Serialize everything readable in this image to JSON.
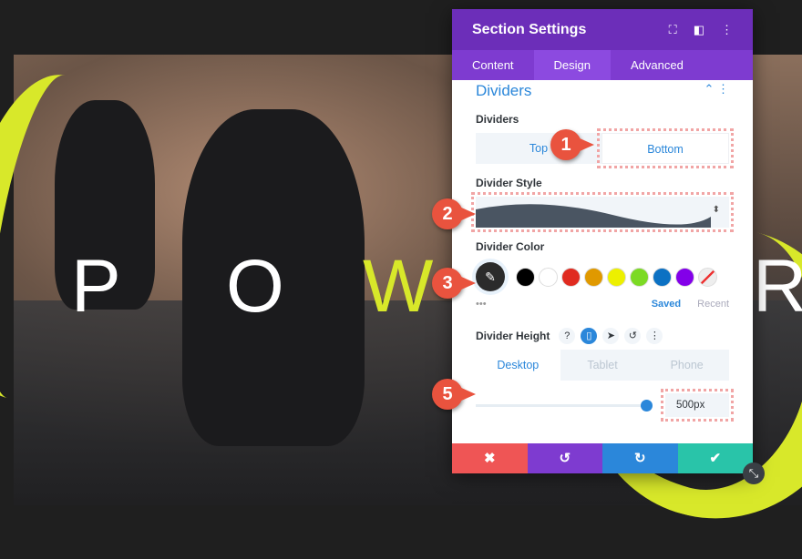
{
  "background": {
    "letters": [
      "P",
      "O",
      "W",
      "R"
    ],
    "accent": "#d8e82a"
  },
  "panel": {
    "title": "Section Settings",
    "header_icons": [
      "fullscreen-icon",
      "sidebar-layout-icon",
      "more-vertical-icon"
    ],
    "tabs": [
      {
        "label": "Content"
      },
      {
        "label": "Design",
        "active": true
      },
      {
        "label": "Advanced"
      }
    ],
    "section_title": "Dividers",
    "dividers": {
      "label": "Dividers",
      "options": [
        "Top",
        "Bottom"
      ],
      "selected": "Bottom"
    },
    "divider_style": {
      "label": "Divider Style"
    },
    "divider_color": {
      "label": "Divider Color",
      "swatches": [
        "#000000",
        "#ffffff",
        "#e02b20",
        "#e09900",
        "#edf000",
        "#7cda24",
        "#0c71c3",
        "#8300e9"
      ],
      "saved": "Saved",
      "recent": "Recent",
      "more": "•••"
    },
    "divider_height": {
      "label": "Divider Height",
      "help": "?",
      "devices": [
        "Desktop",
        "Tablet",
        "Phone"
      ],
      "selected_device": "Desktop",
      "value": "500px"
    },
    "footer": {
      "cancel": "✖",
      "undo": "↺",
      "redo": "↻",
      "save": "✔",
      "colors": [
        "#ef5555",
        "#7e3bd0",
        "#2b87da",
        "#29c4a9"
      ]
    }
  },
  "callouts": [
    "1",
    "2",
    "3",
    "5"
  ]
}
